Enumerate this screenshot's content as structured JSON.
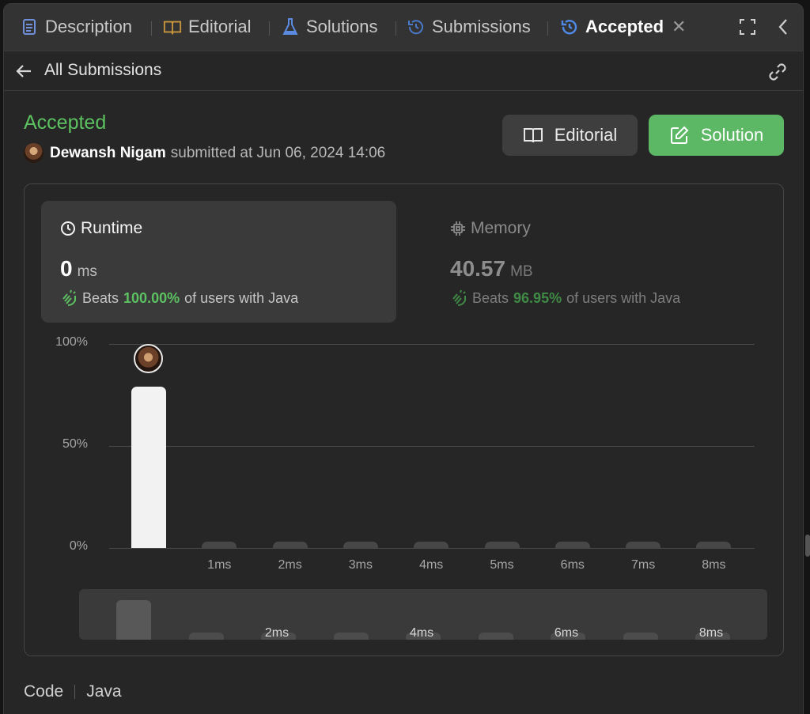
{
  "tabs": [
    {
      "label": "Description",
      "icon": "document-icon"
    },
    {
      "label": "Editorial",
      "icon": "book-icon"
    },
    {
      "label": "Solutions",
      "icon": "flask-icon"
    },
    {
      "label": "Submissions",
      "icon": "history-icon"
    },
    {
      "label": "Accepted",
      "icon": "history-icon",
      "active": true
    }
  ],
  "nav": {
    "back_label": "All Submissions"
  },
  "submission": {
    "status": "Accepted",
    "user": "Dewansh Nigam",
    "submitted_text": "submitted at Jun 06, 2024 14:06",
    "editorial_label": "Editorial",
    "solution_label": "Solution"
  },
  "runtime": {
    "title": "Runtime",
    "value": "0",
    "unit": "ms",
    "beats_label": "Beats",
    "beats_pct": "100.00%",
    "beats_suffix": "of users with Java"
  },
  "memory": {
    "title": "Memory",
    "value": "40.57",
    "unit": "MB",
    "beats_label": "Beats",
    "beats_pct": "96.95%",
    "beats_suffix": "of users with Java"
  },
  "chart_data": {
    "type": "bar",
    "categories": [
      "0ms",
      "1ms",
      "2ms",
      "3ms",
      "4ms",
      "5ms",
      "6ms",
      "7ms",
      "8ms"
    ],
    "x_tick_labels": [
      "",
      "1ms",
      "2ms",
      "3ms",
      "4ms",
      "5ms",
      "6ms",
      "7ms",
      "8ms"
    ],
    "values": [
      79,
      0.5,
      0.5,
      0.5,
      0.5,
      0.5,
      0.5,
      0.5,
      0.5
    ],
    "y_ticks": [
      "100%",
      "50%",
      "0%"
    ],
    "ylim": [
      0,
      100
    ],
    "highlight_index": 0,
    "overview_labels": [
      "2ms",
      "4ms",
      "6ms",
      "8ms"
    ]
  },
  "code_section": {
    "label": "Code",
    "language": "Java"
  },
  "colors": {
    "accent_green": "#5cc160",
    "button_green": "#5cb865",
    "bar_active": "#f2f2f2",
    "bar_inactive": "#474747"
  }
}
